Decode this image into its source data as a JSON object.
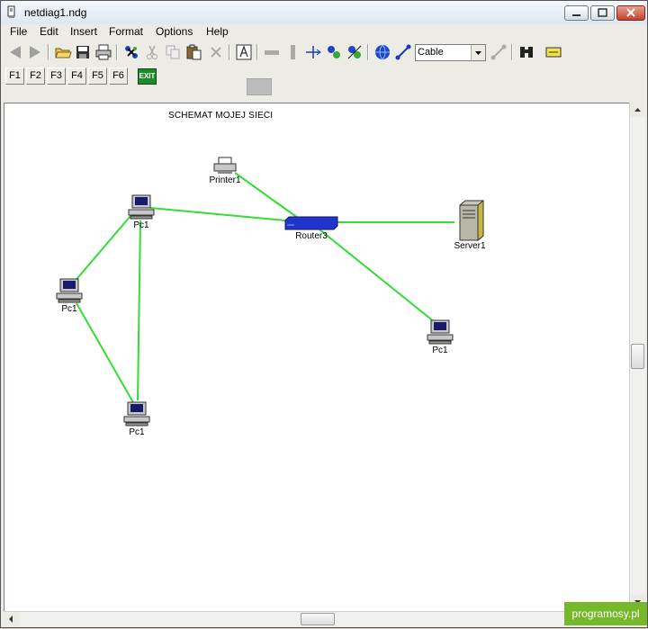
{
  "window": {
    "title": "netdiag1.ndg"
  },
  "menu": {
    "items": [
      "File",
      "Edit",
      "Insert",
      "Format",
      "Options",
      "Help"
    ]
  },
  "toolbar": {
    "cable_combo_value": "Cable",
    "exit_label": "EXIT"
  },
  "fkeys": [
    "F1",
    "F2",
    "F3",
    "F4",
    "F5",
    "F6"
  ],
  "diagram": {
    "title": "SCHEMAT MOJEJ SIECI",
    "nodes": [
      {
        "id": "printer1",
        "type": "printer",
        "label": "Printer1"
      },
      {
        "id": "pc-top",
        "type": "pc",
        "label": "Pc1"
      },
      {
        "id": "router3",
        "type": "router",
        "label": "Router3"
      },
      {
        "id": "server1",
        "type": "server",
        "label": "Server1"
      },
      {
        "id": "pc-left",
        "type": "pc",
        "label": "Pc1"
      },
      {
        "id": "pc-right",
        "type": "pc",
        "label": "Pc1"
      },
      {
        "id": "pc-bottom",
        "type": "pc",
        "label": "Pc1"
      }
    ],
    "link_color": "#33dd33",
    "router_color": "#2233cc"
  },
  "watermark": "programosy.pl"
}
